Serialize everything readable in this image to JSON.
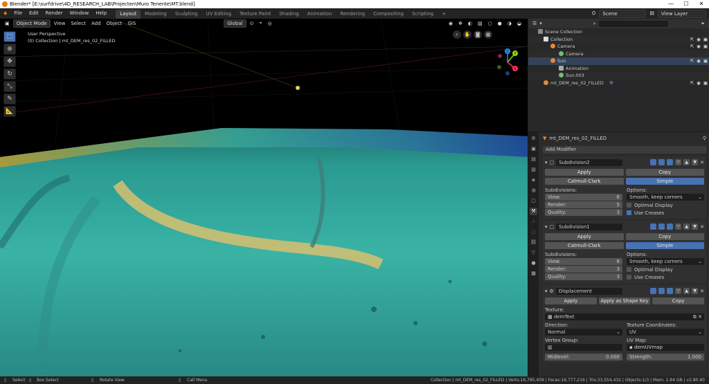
{
  "titlebar": {
    "title": "Blender* [E:\\surfdrive\\4D_RESEARCH_LAB\\Projecten\\Muro Tenente\\MT.blend]",
    "min": "—",
    "max": "☐",
    "close": "✕"
  },
  "menu": {
    "items": [
      "File",
      "Edit",
      "Render",
      "Window",
      "Help"
    ]
  },
  "workspaces": [
    "Layout",
    "Modeling",
    "Sculpting",
    "UV Editing",
    "Texture Paint",
    "Shading",
    "Animation",
    "Rendering",
    "Compositing",
    "Scripting"
  ],
  "workspace_add": "+",
  "scene": {
    "label": "Scene",
    "view_layer": "View Layer"
  },
  "viewport": {
    "mode": "Object Mode",
    "menus": [
      "View",
      "Select",
      "Add",
      "Object",
      "GIS"
    ],
    "orientation": "Global",
    "info_line1": "User Perspective",
    "info_line2": "(0) Collection | mt_DEM_res_02_FILLED"
  },
  "gizmo": {
    "x": "X",
    "y": "Y",
    "z": "Z"
  },
  "outliner": {
    "search_placeholder": "",
    "rows": [
      {
        "label": "Scene Collection"
      },
      {
        "label": "Collection"
      },
      {
        "label": "Camera"
      },
      {
        "label": "Camera"
      },
      {
        "label": "Sun"
      },
      {
        "label": "Animation"
      },
      {
        "label": "Sun.003"
      },
      {
        "label": "mt_DEM_res_02_FILLED"
      }
    ]
  },
  "properties": {
    "object_name": "mt_DEM_res_02_FILLED",
    "add_modifier": "Add Modifier",
    "sub2": {
      "name": "Subdivision2",
      "apply": "Apply",
      "copy": "Copy",
      "catmull": "Catmull-Clark",
      "simple": "Simple",
      "subdivisions": "Subdivisions:",
      "view_label": "View:",
      "view": "6",
      "render_label": "Render:",
      "render": "5",
      "quality_label": "Quality:",
      "quality": "3",
      "options": "Options:",
      "uv_smooth": "Smooth, keep corners",
      "optimal": "Optimal Display",
      "creases": "Use Creases"
    },
    "sub1": {
      "name": "Subdivision1",
      "apply": "Apply",
      "copy": "Copy",
      "catmull": "Catmull-Clark",
      "simple": "Simple",
      "subdivisions": "Subdivisions:",
      "view_label": "View:",
      "view": "6",
      "render_label": "Render:",
      "render": "3",
      "quality_label": "Quality:",
      "quality": "3",
      "options": "Options:",
      "uv_smooth": "Smooth, keep corners",
      "optimal": "Optimal Display",
      "creases": "Use Creases"
    },
    "disp": {
      "name": "Displacement",
      "apply": "Apply",
      "apply_shape": "Apply as Shape Key",
      "copy": "Copy",
      "texture_label": "Texture:",
      "texture": "demText",
      "direction_label": "Direction:",
      "direction": "Normal",
      "texcoords_label": "Texture Coordinates:",
      "texcoords": "UV",
      "vgroup_label": "Vertex Group:",
      "uvmap_label": "UV Map:",
      "uvmap": "demUVmap",
      "midlevel_label": "Midlevel:",
      "midlevel": "0.000",
      "strength_label": "Strength:",
      "strength": "1.000"
    }
  },
  "status": {
    "select": "Select",
    "box_select": "Box Select",
    "rotate": "Rotate View",
    "call_menu": "Call Menu",
    "stats": "Collection | mt_DEM_res_02_FILLED | Verts:16,785,409 | Faces:16,777,216 | Tris:33,554,432 | Objects:1/3 | Mem: 2.84 GB | v2.80.60"
  },
  "colors": {
    "accent": "#4772b3",
    "terrain_low": "#2bb2a6",
    "terrain_high": "#e0b83a"
  }
}
